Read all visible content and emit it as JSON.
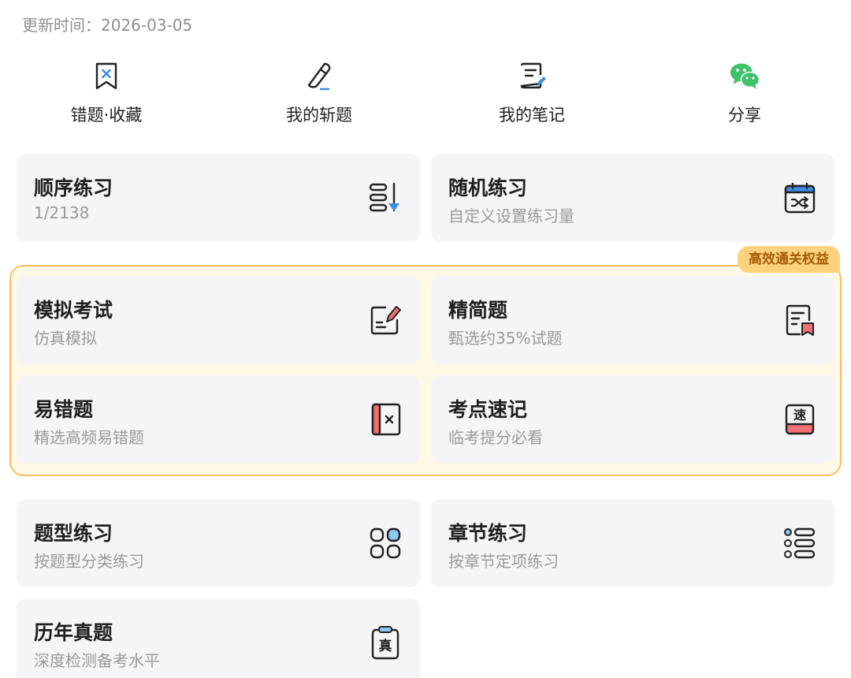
{
  "update": {
    "label": "更新时间：2026-03-05"
  },
  "quick": {
    "items": [
      {
        "label": "错题·收藏",
        "icon": "bookmark-x-icon"
      },
      {
        "label": "我的斩题",
        "icon": "knife-icon"
      },
      {
        "label": "我的笔记",
        "icon": "note-icon"
      },
      {
        "label": "分享",
        "icon": "wechat-icon"
      }
    ]
  },
  "cards": {
    "sequential": {
      "title": "顺序练习",
      "sub": "1/2138",
      "icon": "sort-down-icon"
    },
    "random": {
      "title": "随机练习",
      "sub": "自定义设置练习量",
      "icon": "shuffle-calendar-icon"
    },
    "mock": {
      "title": "模拟考试",
      "sub": "仿真模拟",
      "icon": "edit-pad-icon"
    },
    "concise": {
      "title": "精简题",
      "sub": "甄选约35%试题",
      "icon": "doc-bookmark-icon"
    },
    "error_prone": {
      "title": "易错题",
      "sub": "精选高频易错题",
      "icon": "book-x-icon"
    },
    "quick_notes": {
      "title": "考点速记",
      "sub": "临考提分必看",
      "icon": "speed-card-icon",
      "glyph": "速"
    },
    "by_type": {
      "title": "题型练习",
      "sub": "按题型分类练习",
      "icon": "grid-icon"
    },
    "by_chapter": {
      "title": "章节练习",
      "sub": "按章节定项练习",
      "icon": "list-icon"
    },
    "past_papers": {
      "title": "历年真题",
      "sub": "深度检测备考水平",
      "icon": "clipboard-icon",
      "glyph": "真"
    }
  },
  "vip": {
    "badge": "高效通关权益"
  },
  "colors": {
    "accent_blue": "#3b8ee8",
    "accent_red": "#ef6f72",
    "accent_green": "#3cc36a",
    "vip_border": "#f6c065"
  }
}
